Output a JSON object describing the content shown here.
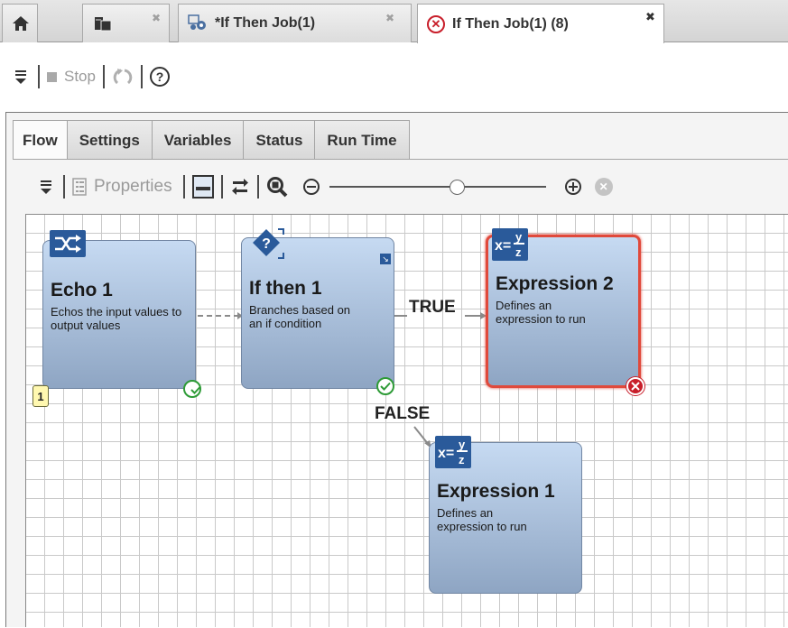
{
  "window_tabs": [
    {
      "label": "",
      "icon": "home-icon"
    },
    {
      "label": "",
      "icon": "folders-icon",
      "close": "✖"
    },
    {
      "label": "*If Then Job(1)",
      "icon": "job-gear-icon",
      "close": "✖"
    },
    {
      "label": "If Then Job(1) (8)",
      "icon": "error-icon",
      "close": "✖"
    }
  ],
  "toolbar": {
    "stop_label": "Stop"
  },
  "subtabs": [
    "Flow",
    "Settings",
    "Variables",
    "Status",
    "Run Time"
  ],
  "flow_toolbar": {
    "properties_label": "Properties",
    "zoom_level": 0.6
  },
  "nodes": [
    {
      "title": "Echo 1",
      "description": "Echos the input values to output values",
      "status": "ok",
      "badge": "1"
    },
    {
      "title": "If then 1",
      "description": "Branches based on an if condition",
      "status": "ok"
    },
    {
      "title": "Expression 2",
      "description": "Defines an expression to run",
      "status": "error"
    },
    {
      "title": "Expression 1",
      "description": "Defines an expression to run",
      "status": "none"
    }
  ],
  "connections": {
    "true_label": "TRUE",
    "false_label": "FALSE"
  },
  "colors": {
    "node_top": "#c6daf2",
    "node_bottom": "#8ea5c3",
    "error": "#e0493b",
    "ok": "#2e9b37"
  }
}
